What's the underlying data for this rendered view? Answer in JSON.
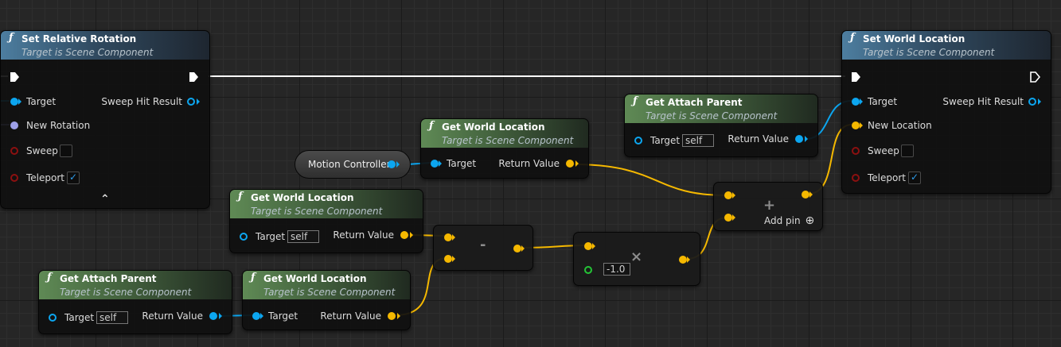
{
  "nodes": {
    "set_relative_rotation": {
      "title": "Set Relative Rotation",
      "subtitle": "Target is Scene Component",
      "target_label": "Target",
      "sweep_hit_result_label": "Sweep Hit Result",
      "new_rotation_label": "New Rotation",
      "sweep_label": "Sweep",
      "sweep_checked": "",
      "teleport_label": "Teleport",
      "teleport_checked": "✓",
      "expand_glyph": "⌃"
    },
    "set_world_location": {
      "title": "Set World Location",
      "subtitle": "Target is Scene Component",
      "target_label": "Target",
      "sweep_hit_result_label": "Sweep Hit Result",
      "new_location_label": "New Location",
      "sweep_label": "Sweep",
      "sweep_checked": "",
      "teleport_label": "Teleport",
      "teleport_checked": "✓"
    },
    "get_attach_parent_top": {
      "title": "Get Attach Parent",
      "subtitle": "Target is Scene Component",
      "target_label": "Target",
      "target_value": "self",
      "return_label": "Return Value"
    },
    "get_world_location_top": {
      "title": "Get World Location",
      "subtitle": "Target is Scene Component",
      "target_label": "Target",
      "return_label": "Return Value"
    },
    "motion_controller": {
      "label": "Motion Controller"
    },
    "get_world_location_mid": {
      "title": "Get World Location",
      "subtitle": "Target is Scene Component",
      "target_label": "Target",
      "target_value": "self",
      "return_label": "Return Value"
    },
    "get_attach_parent_bottom": {
      "title": "Get Attach Parent",
      "subtitle": "Target is Scene Component",
      "target_label": "Target",
      "target_value": "self",
      "return_label": "Return Value"
    },
    "get_world_location_bottom": {
      "title": "Get World Location",
      "subtitle": "Target is Scene Component",
      "target_label": "Target",
      "return_label": "Return Value"
    },
    "subtract": {
      "symbol": "-"
    },
    "multiply": {
      "symbol": "×",
      "input_value": "-1.0"
    },
    "add": {
      "symbol": "+",
      "add_pin_label": "Add pin",
      "add_pin_glyph": "⊕"
    }
  },
  "colors": {
    "exec_wire": "#ffffff",
    "object_wire": "#0ca6f0",
    "vector_wire": "#f5b800",
    "rotator_pin": "#9d9fe8",
    "bool_pin": "#8c1010",
    "float_pin": "#24c436",
    "function_header": "#4d7ea0",
    "pure_header": "#5f8a55"
  },
  "icons": {
    "function": "function-f-icon",
    "exec": "exec-pin-icon",
    "checkbox": "check-icon",
    "expand": "chevron-up-icon",
    "add_pin": "plus-circle-icon"
  }
}
